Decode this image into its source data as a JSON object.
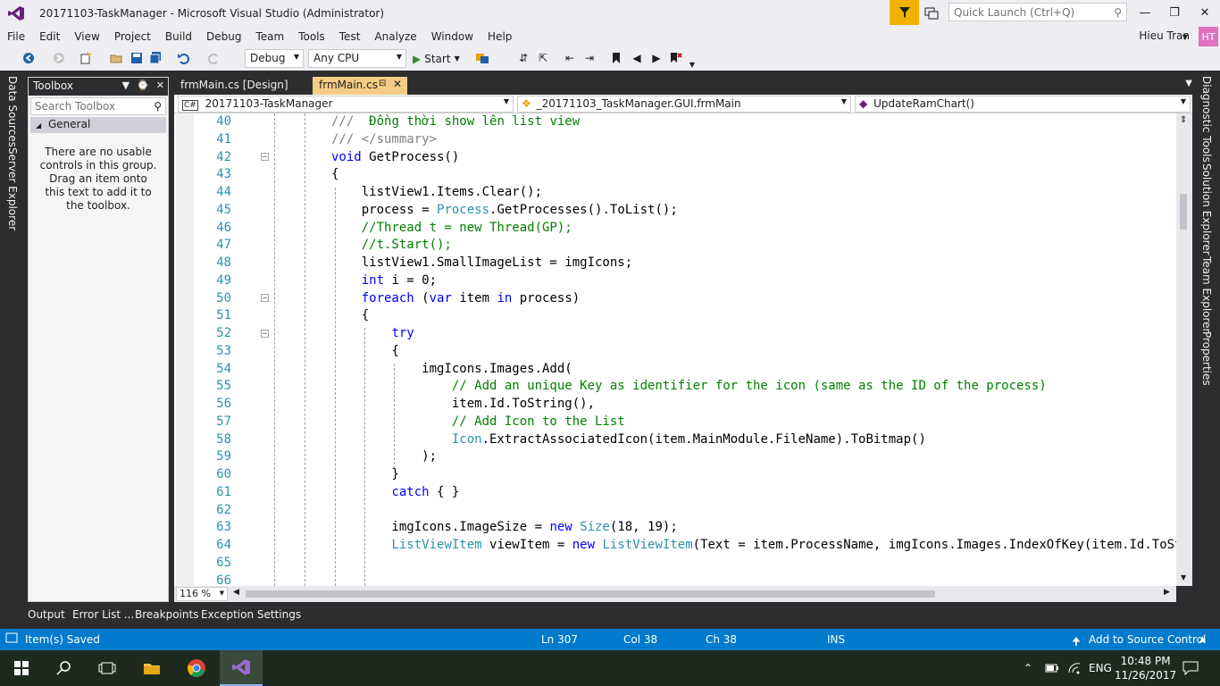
{
  "window": {
    "title": "20171103-TaskManager - Microsoft Visual Studio  (Administrator)",
    "quick_launch_placeholder": "Quick Launch (Ctrl+Q)",
    "user_name": "Hieu Tran",
    "user_initials": "HT"
  },
  "menu": [
    "File",
    "Edit",
    "View",
    "Project",
    "Build",
    "Debug",
    "Team",
    "Tools",
    "Test",
    "Analyze",
    "Window",
    "Help"
  ],
  "toolbar": {
    "config": "Debug",
    "platform": "Any CPU",
    "start_label": "Start"
  },
  "left_tabs": [
    "Data Sources",
    "Server Explorer"
  ],
  "right_tabs": [
    "Diagnostic Tools",
    "Solution Explorer",
    "Team Explorer",
    "Properties"
  ],
  "toolbox": {
    "title": "Toolbox",
    "search_placeholder": "Search Toolbox",
    "group": "General",
    "empty_message": "There are no usable controls in this group. Drag an item onto this text to add it to the toolbox."
  },
  "doc_tabs": {
    "inactive": "frmMain.cs [Design]",
    "active": "frmMain.cs"
  },
  "nav": {
    "project": "20171103-TaskManager",
    "class": "_20171103_TaskManager.GUI.frmMain",
    "member": "UpdateRamChart()"
  },
  "code": {
    "lines": [
      "40",
      "41",
      "42",
      "43",
      "44",
      "45",
      "46",
      "47",
      "48",
      "49",
      "50",
      "51",
      "52",
      "53",
      "54",
      "55",
      "56",
      "57",
      "58",
      "59",
      "60",
      "61",
      "62",
      "63",
      "64",
      "65",
      "66"
    ],
    "zoom": "116 %"
  },
  "bottom_tabs": [
    "Output",
    "Error List ...",
    "Breakpoints",
    "Exception Settings"
  ],
  "status": {
    "message": "Item(s) Saved",
    "line": "Ln 307",
    "col": "Col 38",
    "ch": "Ch 38",
    "mode": "INS",
    "source_control": "Add to Source Control"
  },
  "taskbar": {
    "language": "ENG",
    "time": "10:48 PM",
    "date": "11/26/2017"
  },
  "colors": {
    "accent": "#007acc",
    "keyword": "#0000ff",
    "type": "#2b91af",
    "comment": "#008000",
    "active_tab": "#f5cc84"
  }
}
